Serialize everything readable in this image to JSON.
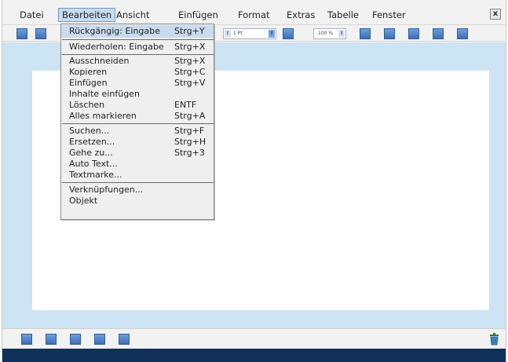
{
  "menubar": {
    "items": [
      "Datei",
      "Bearbeiten",
      "Ansicht",
      "Einfügen",
      "Format",
      "Extras",
      "Tabelle",
      "Fenster"
    ],
    "close_label": "x"
  },
  "toolbar": {
    "line_width": "1 Pt",
    "zoom": "100 %"
  },
  "edit_menu": {
    "groups": [
      [
        {
          "label": "Rückgängig: Eingabe",
          "shortcut": "Strg+Y"
        }
      ],
      [
        {
          "label": "Wiederholen: Eingabe",
          "shortcut": "Strg+X"
        }
      ],
      [
        {
          "label": "Ausschneiden",
          "shortcut": "Strg+X"
        },
        {
          "label": "Kopieren",
          "shortcut": "Strg+C"
        },
        {
          "label": "Einfügen",
          "shortcut": "Strg+V"
        },
        {
          "label": "Inhalte einfügen",
          "shortcut": ""
        },
        {
          "label": "Löschen",
          "shortcut": "ENTF"
        },
        {
          "label": "Alles markieren",
          "shortcut": "Strg+A"
        }
      ],
      [
        {
          "label": "Suchen...",
          "shortcut": "Strg+F"
        },
        {
          "label": "Ersetzen...",
          "shortcut": "Strg+H"
        },
        {
          "label": "Gehe zu...",
          "shortcut": "Strg+3"
        },
        {
          "label": "Auto Text...",
          "shortcut": ""
        },
        {
          "label": "Textmarke...",
          "shortcut": ""
        }
      ],
      [
        {
          "label": "Verknüpfungen...",
          "shortcut": ""
        },
        {
          "label": "Objekt",
          "shortcut": ""
        }
      ]
    ]
  },
  "colors": {
    "accent": "#4a7fc4",
    "highlight": "#c9dbee",
    "workspace": "#cce4f4",
    "statusbar": "#10305a"
  },
  "icons": [
    "toolbar-button-icon",
    "spinner-icon",
    "trash-icon",
    "close-icon"
  ]
}
